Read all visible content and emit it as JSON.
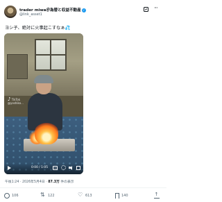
{
  "tweet": {
    "display_name": "trader miwa＠為替と収益不動産",
    "handle": "@link_asset1",
    "text": "ヨシ子、絶対に火事起こすなぁ💦",
    "timestamp": "午後1:24 · 2026年5月4日 · ",
    "views_count": "87.3万",
    "views_label": " 件の表示"
  },
  "video": {
    "watermark_brand": "TikTok",
    "watermark_handle": "@yoshiko...",
    "time": "0:00 / 1:05",
    "cc_label": "CC"
  },
  "actions": {
    "replies": "106",
    "reposts": "122",
    "likes": "613",
    "bookmarks": "140"
  },
  "colors": {
    "verified": "#1d9bf0",
    "text": "#0f1419",
    "secondary": "#536471"
  }
}
